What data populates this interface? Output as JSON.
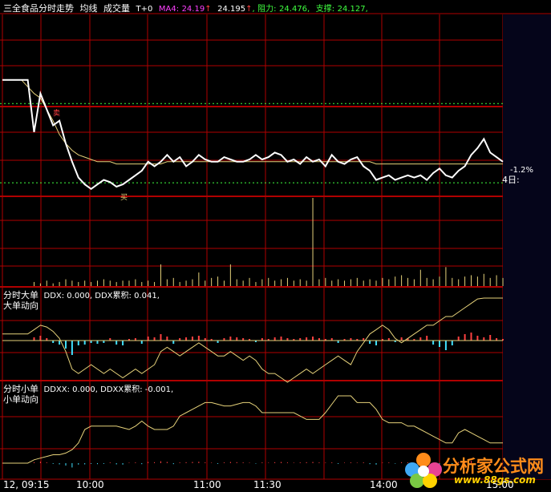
{
  "header": {
    "title": "三全食品分时走势",
    "tabs": [
      "均线",
      "成交量",
      "T+0"
    ],
    "ma4_label": "MA4:",
    "ma4_value": "24.19",
    "ma4_value2": "24.195",
    "resistance_label": "阻力:",
    "resistance_value": "24.476,",
    "support_label": "支撑:",
    "support_value": "24.127,",
    "arrow": "↑"
  },
  "price_panel": {
    "change_pct": "-1.2%",
    "days_label": "4日:",
    "marker_left": "卖",
    "marker_right": "买"
  },
  "ddx_panel": {
    "title": "分时大单",
    "ddx_text": "DDX: 0.000, DDX累积: 0.041,",
    "subtitle": "大单动向"
  },
  "ddxx_panel": {
    "title": "分时小单",
    "ddxx_text": "DDXX: 0.000, DDXX累积: -0.001,",
    "subtitle": "小单动向"
  },
  "time_axis": [
    "12, 09:15",
    "10:00",
    "11:00",
    "11:30",
    "14:00",
    "15:00"
  ],
  "watermark": {
    "name": "分析家公式网",
    "url": "www.88gs.com"
  },
  "colors": {
    "grid": "#b00000",
    "price_line": "#ffffff",
    "avg_line": "#e6d27a",
    "volume": "#e6d27a",
    "ddx_pos": "#ff4040",
    "ddx_neg": "#40e0ff",
    "title": "#ffffff",
    "ma4": "#ff40ff",
    "resistance": "#40ff40",
    "support": "#40ff40"
  },
  "chart_data": {
    "type": "line",
    "title": "三全食品分时走势",
    "series": [
      {
        "name": "price",
        "values": [
          24.58,
          24.58,
          24.58,
          24.58,
          24.58,
          24.35,
          24.52,
          24.45,
          24.38,
          24.4,
          24.3,
          24.22,
          24.15,
          24.12,
          24.1,
          24.12,
          24.14,
          24.13,
          24.11,
          24.12,
          24.14,
          24.16,
          24.18,
          24.22,
          24.2,
          24.22,
          24.25,
          24.22,
          24.24,
          24.2,
          24.22,
          24.25,
          24.23,
          24.22,
          24.22,
          24.24,
          24.23,
          24.22,
          24.22,
          24.23,
          24.25,
          24.23,
          24.24,
          24.26,
          24.25,
          24.22,
          24.23,
          24.21,
          24.24,
          24.22,
          24.23,
          24.2,
          24.25,
          24.22,
          24.21,
          24.23,
          24.24,
          24.2,
          24.18,
          24.14,
          24.15,
          24.16,
          24.14,
          24.15,
          24.16,
          24.15,
          24.16,
          24.14,
          24.17,
          24.19,
          24.16,
          24.15,
          24.18,
          24.2,
          24.25,
          24.28,
          24.32,
          24.26,
          24.24,
          24.22
        ]
      },
      {
        "name": "average",
        "values": [
          24.58,
          24.58,
          24.58,
          24.58,
          24.55,
          24.52,
          24.5,
          24.45,
          24.4,
          24.34,
          24.3,
          24.27,
          24.25,
          24.24,
          24.23,
          24.22,
          24.22,
          24.22,
          24.21,
          24.21,
          24.21,
          24.21,
          24.21,
          24.21,
          24.21,
          24.21,
          24.22,
          24.22,
          24.22,
          24.22,
          24.22,
          24.22,
          24.22,
          24.22,
          24.22,
          24.22,
          24.22,
          24.22,
          24.22,
          24.22,
          24.22,
          24.22,
          24.22,
          24.22,
          24.22,
          24.22,
          24.22,
          24.22,
          24.22,
          24.22,
          24.22,
          24.22,
          24.22,
          24.22,
          24.22,
          24.22,
          24.22,
          24.22,
          24.22,
          24.21,
          24.21,
          24.21,
          24.21,
          24.21,
          24.21,
          24.21,
          24.21,
          24.21,
          24.21,
          24.21,
          24.21,
          24.21,
          24.21,
          24.21,
          24.21,
          24.21,
          24.21,
          24.21,
          24.21,
          24.21
        ]
      },
      {
        "name": "volume",
        "values": [
          0,
          0,
          0,
          0,
          0,
          3,
          2,
          4,
          2,
          3,
          5,
          4,
          3,
          4,
          3,
          4,
          5,
          4,
          3,
          4,
          4,
          5,
          3,
          4,
          3,
          16,
          5,
          6,
          3,
          4,
          5,
          10,
          4,
          6,
          7,
          4,
          16,
          5,
          4,
          6,
          3,
          5,
          6,
          4,
          5,
          6,
          4,
          5,
          4,
          65,
          5,
          6,
          4,
          5,
          4,
          5,
          6,
          4,
          5,
          4,
          6,
          5,
          7,
          8,
          6,
          5,
          12,
          6,
          5,
          7,
          14,
          6,
          5,
          7,
          8,
          7,
          9,
          6,
          8,
          6
        ]
      },
      {
        "name": "ddx",
        "values": [
          0,
          0,
          0,
          0,
          0,
          0.4,
          0.6,
          0.3,
          -0.3,
          -0.5,
          -1.0,
          -1.8,
          -0.6,
          -0.5,
          -0.3,
          -0.4,
          -0.3,
          0.3,
          -0.5,
          -0.6,
          0.2,
          0.3,
          -0.4,
          0.5,
          0.4,
          0.8,
          0.5,
          -0.4,
          0.3,
          0.4,
          0.5,
          0.6,
          0.3,
          0.2,
          -0.3,
          0.3,
          0.5,
          0.4,
          0.3,
          0.2,
          -0.2,
          0.3,
          0.2,
          0.4,
          0.5,
          0.3,
          0.2,
          0.3,
          0.4,
          0.5,
          0.3,
          0.2,
          0.3,
          -0.3,
          0.2,
          0.3,
          0.2,
          0.3,
          -0.4,
          -0.6,
          0.2,
          0.3,
          -0.2,
          0.4,
          0.3,
          0.2,
          0.4,
          0.6,
          -0.5,
          -0.8,
          -1.2,
          -0.6,
          0.5,
          0.8,
          1.0,
          0.6,
          0.4,
          0.7,
          0.3,
          0.2
        ]
      },
      {
        "name": "ddx_cum",
        "values": [
          0,
          0,
          0,
          0,
          0,
          0.005,
          0.01,
          0.008,
          0.003,
          -0.005,
          -0.02,
          -0.04,
          -0.045,
          -0.04,
          -0.035,
          -0.04,
          -0.045,
          -0.04,
          -0.045,
          -0.05,
          -0.045,
          -0.04,
          -0.045,
          -0.04,
          -0.035,
          -0.02,
          -0.015,
          -0.02,
          -0.025,
          -0.02,
          -0.015,
          -0.01,
          -0.015,
          -0.02,
          -0.025,
          -0.025,
          -0.02,
          -0.025,
          -0.03,
          -0.025,
          -0.03,
          -0.04,
          -0.045,
          -0.045,
          -0.05,
          -0.055,
          -0.05,
          -0.045,
          -0.04,
          -0.045,
          -0.04,
          -0.035,
          -0.03,
          -0.025,
          -0.03,
          -0.035,
          -0.02,
          -0.01,
          0.0,
          0.005,
          0.01,
          0.005,
          -0.005,
          -0.01,
          -0.005,
          0.0,
          0.005,
          0.01,
          0.01,
          0.015,
          0.02,
          0.02,
          0.025,
          0.03,
          0.035,
          0.04,
          0.041,
          0.041,
          0.041,
          0.041
        ]
      },
      {
        "name": "ddxx_cum",
        "values": [
          0,
          0,
          0,
          0,
          0,
          0.002,
          0.003,
          0.004,
          0.005,
          0.005,
          0.006,
          0.008,
          0.012,
          0.02,
          0.022,
          0.022,
          0.022,
          0.022,
          0.022,
          0.021,
          0.02,
          0.022,
          0.025,
          0.022,
          0.02,
          0.02,
          0.02,
          0.022,
          0.028,
          0.03,
          0.032,
          0.034,
          0.036,
          0.036,
          0.035,
          0.034,
          0.034,
          0.035,
          0.036,
          0.036,
          0.034,
          0.03,
          0.03,
          0.03,
          0.03,
          0.03,
          0.03,
          0.028,
          0.026,
          0.026,
          0.026,
          0.03,
          0.035,
          0.04,
          0.04,
          0.04,
          0.036,
          0.036,
          0.036,
          0.032,
          0.026,
          0.024,
          0.024,
          0.024,
          0.022,
          0.022,
          0.02,
          0.018,
          0.016,
          0.014,
          0.012,
          0.012,
          0.018,
          0.02,
          0.018,
          0.016,
          0.014,
          0.012,
          0.012,
          0.012
        ]
      }
    ],
    "resistance": 24.476,
    "support": 24.127,
    "ylim": [
      24.05,
      24.72
    ]
  }
}
